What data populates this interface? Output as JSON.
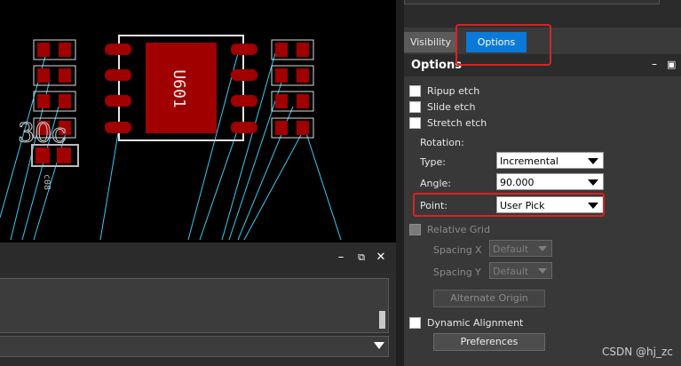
{
  "canvas": {
    "component_ref": "U601",
    "partial_labels": {
      "left_ref": "30c",
      "left_ref_small": "c08"
    }
  },
  "bottom_panel": {
    "minimize_glyph": "–",
    "restore_glyph": "⧉",
    "close_glyph": "✕"
  },
  "tabs": [
    {
      "label": "Visibility",
      "active": false
    },
    {
      "label": "Options",
      "active": true
    }
  ],
  "options_panel": {
    "title": "Options",
    "minimize_glyph": "–",
    "pin_glyph": "▣",
    "ripup_etch": {
      "label": "Ripup etch",
      "checked": false
    },
    "slide_etch": {
      "label": "Slide etch",
      "checked": false
    },
    "stretch_etch": {
      "label": "Stretch etch",
      "checked": false
    },
    "rotation_label": "Rotation:",
    "type": {
      "label": "Type:",
      "value": "Incremental"
    },
    "angle": {
      "label": "Angle:",
      "value": "90.000"
    },
    "point": {
      "label": "Point:",
      "value": "User Pick"
    },
    "relative_grid": {
      "label": "Relative Grid",
      "checked": false
    },
    "spacing_x": {
      "label": "Spacing",
      "axis": "X",
      "value": "Default"
    },
    "spacing_y": {
      "label": "Spacing",
      "axis": "Y",
      "value": "Default"
    },
    "alternate_origin_button": "Alternate Origin",
    "dynamic_alignment": {
      "label": "Dynamic Alignment",
      "checked": false
    },
    "preferences_button": "Preferences"
  },
  "watermark": "CSDN @hj_zc",
  "colors": {
    "pad_red": "#a00000",
    "ratsnest_cyan": "#3fc8ef",
    "highlight_red": "#e02020",
    "tab_active_blue": "#0b79d9"
  }
}
